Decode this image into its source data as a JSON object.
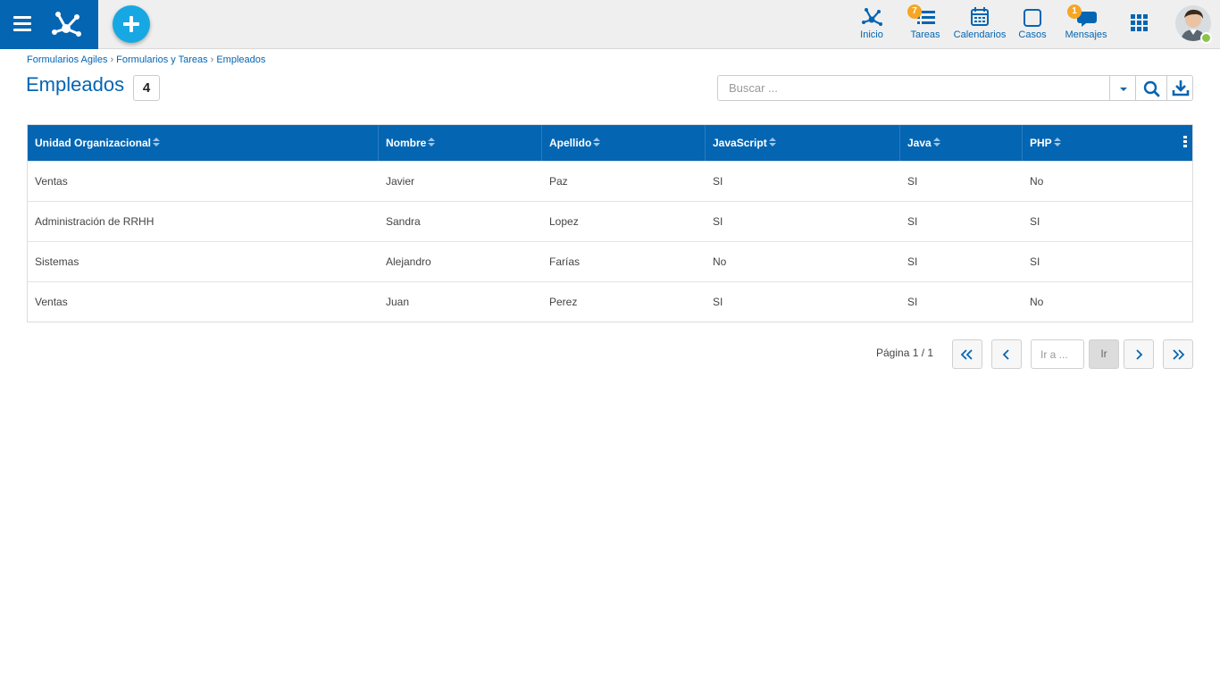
{
  "header": {
    "nav": [
      {
        "label": "Inicio",
        "icon": "home-tree-icon"
      },
      {
        "label": "Tareas",
        "icon": "tasks-icon",
        "badge": "7"
      },
      {
        "label": "Calendarios",
        "icon": "calendar-icon"
      },
      {
        "label": "Casos",
        "icon": "cases-icon"
      },
      {
        "label": "Mensajes",
        "icon": "messages-icon",
        "badge": "1"
      }
    ]
  },
  "breadcrumb": [
    "Formularios Agiles",
    "Formularios y Tareas",
    "Empleados"
  ],
  "page": {
    "title": "Empleados",
    "count": "4"
  },
  "search": {
    "placeholder": "Buscar ..."
  },
  "table": {
    "columns": [
      "Unidad Organizacional",
      "Nombre",
      "Apellido",
      "JavaScript",
      "Java",
      "PHP"
    ],
    "rows": [
      [
        "Ventas",
        "Javier",
        "Paz",
        "SI",
        "SI",
        "No"
      ],
      [
        "Administración de RRHH",
        "Sandra",
        "Lopez",
        "SI",
        "SI",
        "SI"
      ],
      [
        "Sistemas",
        "Alejandro",
        "Farías",
        "No",
        "SI",
        "SI"
      ],
      [
        "Ventas",
        "Juan",
        "Perez",
        "SI",
        "SI",
        "No"
      ]
    ]
  },
  "pager": {
    "label": "Página 1 / 1",
    "goto_placeholder": "Ir a ...",
    "go_label": "Ir"
  },
  "colors": {
    "primary": "#0465b2",
    "accent": "#17a8e3",
    "badge": "#f5a623",
    "online": "#8bc34a"
  }
}
